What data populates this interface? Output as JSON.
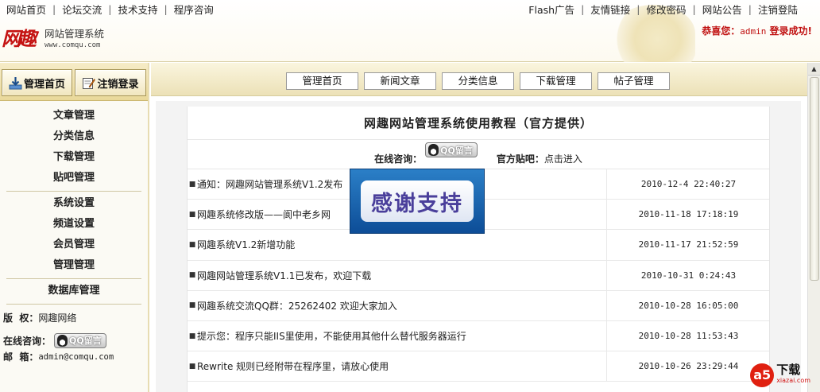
{
  "header": {
    "left_nav": [
      "网站首页",
      "论坛交流",
      "技术支持",
      "程序咨询"
    ],
    "right_nav": [
      "Flash广告",
      "友情链接",
      "修改密码",
      "网站公告",
      "注销登陆"
    ],
    "logo_mark": "网趣",
    "logo_title": "网站管理系统",
    "logo_url": "www.comqu.com",
    "welcome_prefix": "恭喜您：",
    "welcome_user": "admin",
    "welcome_suffix": " 登录成功!"
  },
  "sidebar": {
    "btn_home": "管理首页",
    "btn_logout": "注销登录",
    "groups": [
      [
        "文章管理",
        "分类信息",
        "下载管理",
        "贴吧管理"
      ],
      [
        "系统设置",
        "频道设置",
        "会员管理",
        "管理管理"
      ],
      [
        "数据库管理"
      ]
    ],
    "copyright_label": "版  权：",
    "copyright_value": "网趣网络",
    "contact_label": "在线咨询：",
    "qq_label": "QQ留言",
    "email_label": "邮  箱：",
    "email_value": "admin@comqu.com"
  },
  "tabs": [
    "管理首页",
    "新闻文章",
    "分类信息",
    "下载管理",
    "帖子管理"
  ],
  "panel": {
    "title": "网趣网站管理系统使用教程（官方提供）",
    "contact_label": "在线咨询：",
    "qq_label": "QQ留言",
    "bar_label": "官方贴吧：",
    "bar_link": "点击进入"
  },
  "news": [
    {
      "title": "通知：网趣网站管理系统V1.2发布",
      "date": "2010-12-4 22:40:27"
    },
    {
      "title": "网趣系统修改版——阆中老乡网",
      "date": "2010-11-18 17:18:19"
    },
    {
      "title": "网趣系统V1.2新增功能",
      "date": "2010-11-17 21:52:59"
    },
    {
      "title": "网趣网站管理系统V1.1已发布，欢迎下载",
      "date": "2010-10-31 0:24:43"
    },
    {
      "title": "网趣系统交流QQ群：25262402 欢迎大家加入",
      "date": "2010-10-28 16:05:00"
    },
    {
      "title": "提示您：程序只能IIS里使用，不能使用其他什么替代服务器运行",
      "date": "2010-10-28 11:53:43"
    },
    {
      "title": "Rewrite 规则已经附带在程序里，请放心使用",
      "date": "2010-10-26 23:29:44"
    }
  ],
  "popup": {
    "text": "感谢支持"
  },
  "watermark": {
    "logo": "a5",
    "name": "下载",
    "url": "xiazai.com"
  },
  "icons": {
    "home": "download-arrow-icon",
    "logout": "pencil-note-icon",
    "qq": "qq-penguin-icon"
  },
  "colors": {
    "accent_red": "#c01010",
    "sidebar_bg": "#fbfaf4",
    "header_gold": "#e9d89a",
    "popup_blue": "#0d4d97"
  }
}
